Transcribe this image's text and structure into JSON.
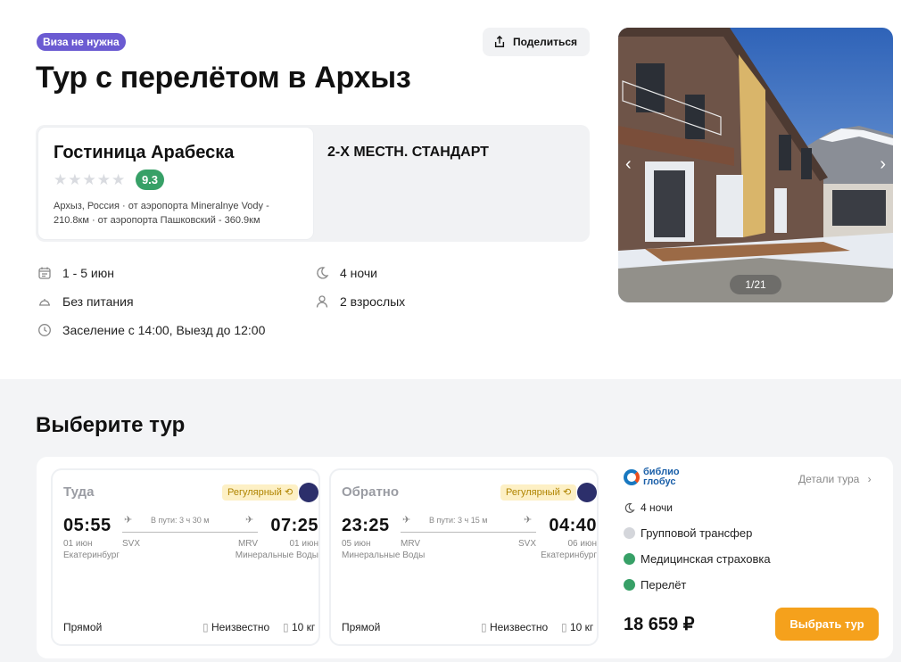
{
  "header": {
    "visa_badge": "Виза не нужна",
    "share_label": "Поделиться",
    "title": "Тур с перелётом в Архыз"
  },
  "hotel": {
    "name": "Гостиница Арабеска",
    "stars_filled": 0,
    "rating": "9.3",
    "location_line1": "Архыз, Россия · от аэропорта Mineralnye Vody -",
    "location_line2": "210.8км · от аэропорта Пашковский - 360.9км",
    "room_type": "2-Х МЕСТН. СТАНДАРТ"
  },
  "info": {
    "dates": "1 - 5 июн",
    "nights": "4 ночи",
    "meals": "Без питания",
    "guests": "2 взрослых",
    "checkin": "Заселение с 14:00, Выезд до 12:00"
  },
  "gallery": {
    "counter": "1/21",
    "prev_icon": "chevron-left-icon",
    "next_icon": "chevron-right-icon"
  },
  "tours": {
    "section_title": "Выберите тур",
    "outbound": {
      "label": "Туда",
      "regular": "Регулярный",
      "dep_time": "05:55",
      "arr_time": "07:25",
      "duration": "В пути: 3 ч 30 м",
      "dep_date": "01 июн",
      "arr_date": "01 июн",
      "dep_code": "SVX",
      "arr_code": "MRV",
      "dep_city": "Екатеринбург",
      "arr_city": "Минеральные Воды",
      "type": "Прямой",
      "luggage_unknown": "Неизвестно",
      "baggage": "10 кг"
    },
    "return": {
      "label": "Обратно",
      "regular": "Регулярный",
      "dep_time": "23:25",
      "arr_time": "04:40",
      "duration": "В пути: 3 ч 15 м",
      "dep_date": "05 июн",
      "arr_date": "06 июн",
      "dep_code": "MRV",
      "arr_code": "SVX",
      "dep_city": "Минеральные Воды",
      "arr_city": "Екатеринбург",
      "type": "Прямой",
      "luggage_unknown": "Неизвестно",
      "baggage": "10 кг"
    },
    "agency": {
      "name_line1": "библио",
      "name_line2": "глобус",
      "details": "Детали тура",
      "nights": "4 ночи",
      "services": [
        {
          "label": "Групповой трансфер",
          "included": false
        },
        {
          "label": "Медицинская страховка",
          "included": true
        },
        {
          "label": "Перелёт",
          "included": true
        }
      ],
      "price": "18 659 ₽",
      "choose_label": "Выбрать тур"
    }
  },
  "colors": {
    "accent": "#f5a11c",
    "visa_badge": "#6b5bd2",
    "rating_green": "#37a067",
    "included_green": "#37a067",
    "not_included_gray": "#d4d6db"
  }
}
